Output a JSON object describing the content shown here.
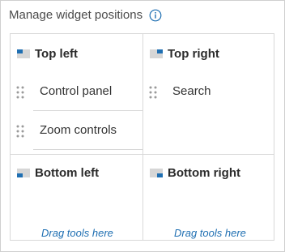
{
  "header": {
    "title": "Manage widget positions",
    "info_icon": "info-icon"
  },
  "colors": {
    "accent": "#1f6fb2",
    "border": "#d8d8d8",
    "text": "#323232"
  },
  "zones": {
    "top_left": {
      "label": "Top left",
      "icon": "layout-top-left-icon",
      "items": [
        {
          "label": "Control panel",
          "icon": "drag-handle-icon"
        },
        {
          "label": "Zoom controls",
          "icon": "drag-handle-icon"
        }
      ]
    },
    "top_right": {
      "label": "Top right",
      "icon": "layout-top-right-icon",
      "items": [
        {
          "label": "Search",
          "icon": "drag-handle-icon"
        }
      ]
    },
    "bottom_left": {
      "label": "Bottom left",
      "icon": "layout-bottom-left-icon",
      "empty_hint": "Drag tools here"
    },
    "bottom_right": {
      "label": "Bottom right",
      "icon": "layout-bottom-right-icon",
      "empty_hint": "Drag tools here"
    }
  }
}
